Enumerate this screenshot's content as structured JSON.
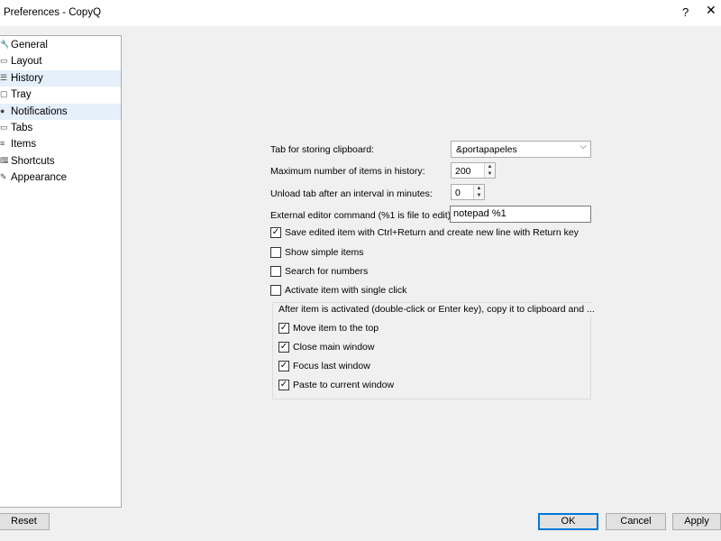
{
  "window": {
    "title": "Preferences - CopyQ",
    "help_label": "?",
    "close_label": "✕"
  },
  "sidebar": {
    "items": [
      {
        "label": "General",
        "icon": "wrench-icon",
        "glyph": "🔧"
      },
      {
        "label": "Layout",
        "icon": "layout-icon",
        "glyph": "▭"
      },
      {
        "label": "History",
        "icon": "list-icon",
        "glyph": "☰"
      },
      {
        "label": "Tray",
        "icon": "tray-icon",
        "glyph": "▢"
      },
      {
        "label": "Notifications",
        "icon": "notification-icon",
        "glyph": "●"
      },
      {
        "label": "Tabs",
        "icon": "tabs-icon",
        "glyph": "▭"
      },
      {
        "label": "Items",
        "icon": "items-icon",
        "glyph": "≡"
      },
      {
        "label": "Shortcuts",
        "icon": "keyboard-icon",
        "glyph": "⌨"
      },
      {
        "label": "Appearance",
        "icon": "paint-icon",
        "glyph": "✎"
      }
    ],
    "selected": "History"
  },
  "history": {
    "tab_label": "Tab for storing clipboard:",
    "tab_value": "&portapapeles",
    "max_items_label": "Maximum number of items in history:",
    "max_items_value": "200",
    "unload_label": "Unload tab after an interval in minutes:",
    "unload_value": "0",
    "editor_label": "External editor command (%1 is file to edit):",
    "editor_value": "notepad %1",
    "checks": [
      {
        "label": "Save edited item with Ctrl+Return and create new line with Return key",
        "checked": true
      },
      {
        "label": "Show simple items",
        "checked": false
      },
      {
        "label": "Search for numbers",
        "checked": false
      },
      {
        "label": "Activate item with single click",
        "checked": false
      }
    ],
    "group_title": "After item is activated (double-click or Enter key), copy it to clipboard and ...",
    "group_checks": [
      {
        "label": "Move item to the top",
        "checked": true
      },
      {
        "label": "Close main window",
        "checked": true
      },
      {
        "label": "Focus last window",
        "checked": true
      },
      {
        "label": "Paste to current window",
        "checked": true
      }
    ]
  },
  "buttons": {
    "reset": "Reset",
    "ok": "OK",
    "cancel": "Cancel",
    "apply": "Apply"
  }
}
